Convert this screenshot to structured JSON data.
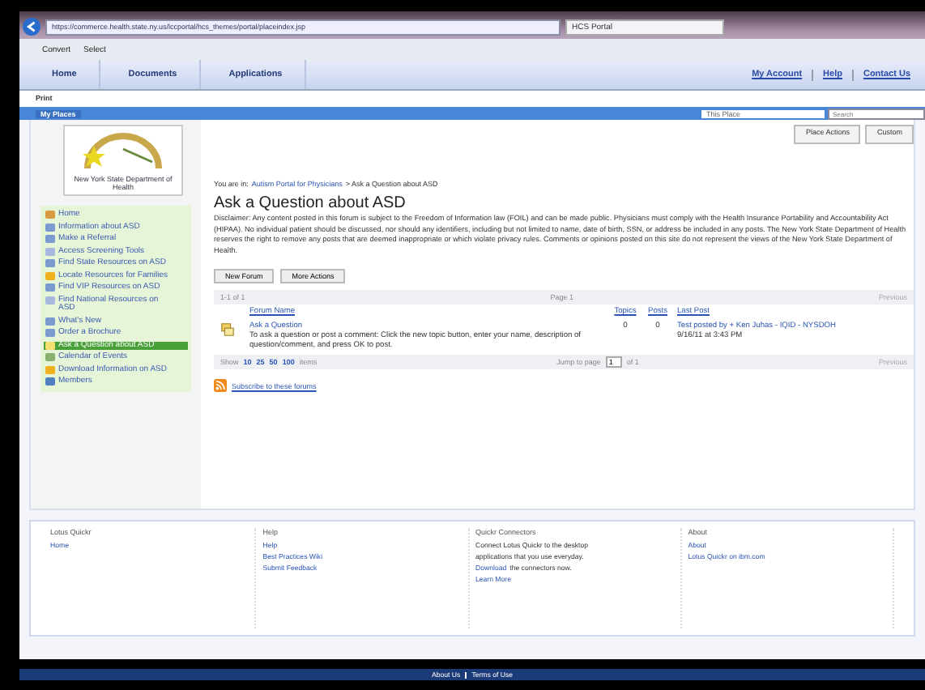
{
  "browser": {
    "url": "https://commerce.health.state.ny.us/lccportal/hcs_themes/portal/placeindex.jsp",
    "tab_title": "HCS Portal",
    "toolbar": [
      "Convert",
      "Select"
    ]
  },
  "nav": {
    "items": [
      {
        "label": "Home",
        "selected": false
      },
      {
        "label": "Documents",
        "selected": false
      },
      {
        "label": "Applications",
        "selected": false
      }
    ],
    "links": [
      "My Account",
      "Help",
      "Contact Us"
    ]
  },
  "print": "Print",
  "places_bar": {
    "title": "My Places",
    "scope": "This Place",
    "search_placeholder": "Search"
  },
  "place_actions": [
    "Place Actions",
    "Custom"
  ],
  "logo_caption": "New York State Department of Health",
  "sidebar": {
    "items": [
      {
        "label": "Home",
        "kind": "home",
        "selected": false
      },
      {
        "label": "Information about ASD",
        "kind": "page",
        "selected": false
      },
      {
        "label": "Make a Referral",
        "kind": "page",
        "selected": false
      },
      {
        "label": "Access Screening Tools",
        "kind": "doc",
        "selected": false
      },
      {
        "label": "Find State Resources on ASD",
        "kind": "page",
        "selected": false
      },
      {
        "label": "Locate Resources for Families",
        "kind": "folder",
        "selected": false
      },
      {
        "label": "Find VIP Resources on ASD",
        "kind": "page",
        "selected": false
      },
      {
        "label": "Find National Resources on ASD",
        "kind": "doc",
        "selected": false
      },
      {
        "label": "What's New",
        "kind": "page",
        "selected": false
      },
      {
        "label": "Order a Brochure",
        "kind": "page",
        "selected": false
      },
      {
        "label": "Ask a Question about ASD",
        "kind": "forum",
        "selected": true
      },
      {
        "label": "Calendar of Events",
        "kind": "calendar",
        "selected": false
      },
      {
        "label": "Download Information on ASD",
        "kind": "folder",
        "selected": false
      },
      {
        "label": "Members",
        "kind": "members",
        "selected": false
      }
    ]
  },
  "breadcrumb": {
    "prefix": "You are in:",
    "link": "Autism Portal for Physicians",
    "current": "> Ask a Question about ASD"
  },
  "heading": "Ask a Question about ASD",
  "disclaimer": "Disclaimer: Any content posted in this forum is subject to the Freedom of Information law (FOIL) and can be made public. Physicians must comply with the Health Insurance Portability and Accountability Act (HIPAA). No individual patient should be discussed, nor should any identifiers, including but not limited to name, date of birth, SSN, or address be included in any posts. The New York State Department of Health reserves the right to remove any posts that are deemed inappropriate or which violate privacy rules. Comments or opinions posted on this site do not represent the views of the New York State Department of Health.",
  "buttons": [
    "New Forum",
    "More Actions"
  ],
  "forum_table": {
    "range": "1-1 of 1",
    "page": "Page 1",
    "previous": "Previous",
    "columns": [
      "Forum Name",
      "Topics",
      "Posts",
      "Last Post"
    ],
    "rows": [
      {
        "name": "Ask a Question",
        "description": "To ask a question or post a comment: Click the new topic button, enter your name, description of question/comment, and press OK to post.",
        "topics": "0",
        "posts": "0",
        "last_post": "Test posted by + Ken Juhas - IQID - NYSDOH",
        "last_post_date": "9/16/11 at 3:43 PM"
      }
    ],
    "pager": {
      "show": "Show",
      "sizes": [
        "10",
        "25",
        "50",
        "100"
      ],
      "items": "items",
      "jump": "Jump to page",
      "page_value": "1",
      "of": "of 1",
      "previous": "Previous"
    }
  },
  "subscribe": "Subscribe to these forums",
  "footer": [
    {
      "title": "Lotus Quickr",
      "lines": [
        {
          "text": "Home",
          "kind": "link"
        }
      ]
    },
    {
      "title": "Help",
      "lines": [
        {
          "text": "Help",
          "kind": "link"
        },
        {
          "text": "Best Practices Wiki",
          "kind": "link"
        },
        {
          "text": "Submit Feedback",
          "kind": "link"
        }
      ]
    },
    {
      "title": "Quickr Connectors",
      "lines": [
        {
          "text": "Connect Lotus Quickr to the desktop",
          "kind": "text"
        },
        {
          "text": "applications that you use everyday.",
          "kind": "text"
        },
        {
          "text": "Download",
          "kind": "link",
          "after": "the connectors now."
        },
        {
          "text": "Learn More",
          "kind": "link"
        }
      ]
    },
    {
      "title": "About",
      "lines": [
        {
          "text": "About",
          "kind": "link"
        },
        {
          "text": "Lotus Quickr on ibm.com",
          "kind": "link"
        }
      ]
    }
  ],
  "bottom_links": [
    "About Us",
    "Terms of Use"
  ]
}
